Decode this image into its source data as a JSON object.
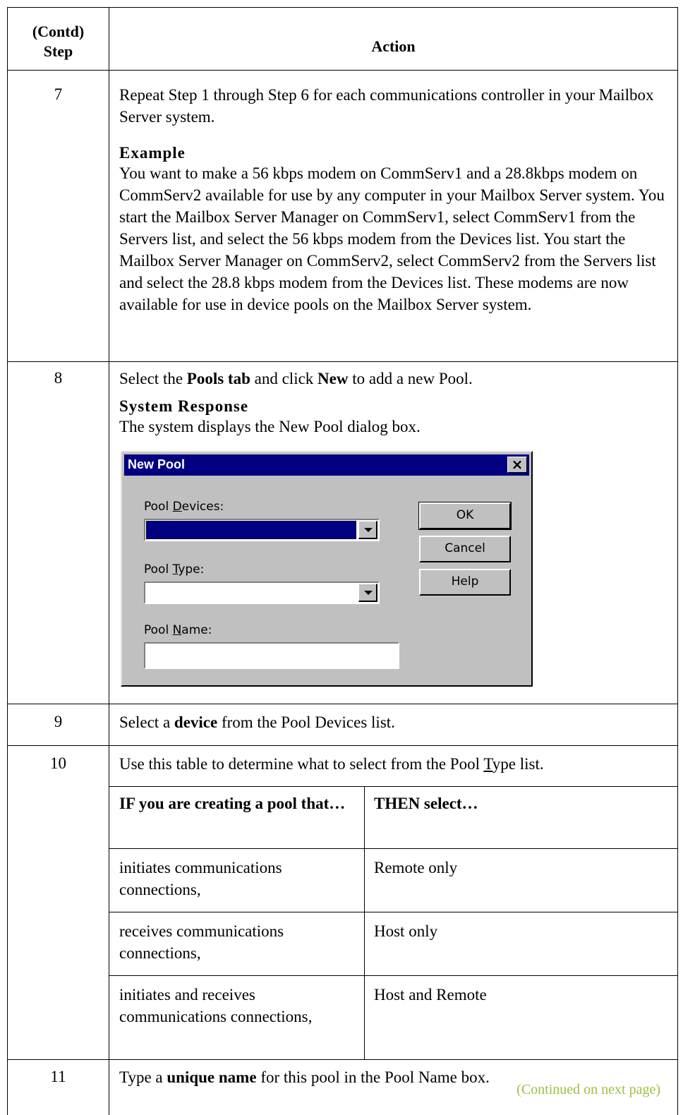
{
  "header": {
    "step_line1": "(Contd)",
    "step_line2": "Step",
    "action": "Action"
  },
  "steps": [
    {
      "num": "7",
      "text": "Repeat Step 1 through Step 6 for each communications controller in your Mailbox Server system.",
      "sub_heading": "Example",
      "sub_text": "You want to make a 56 kbps modem on CommServ1 and a 28.8kbps modem on CommServ2 available for use by any computer in your Mailbox Server system. You start the Mailbox Server Manager on CommServ1, select CommServ1 from the Servers list, and select the 56 kbps modem from the Devices list. You start the Mailbox Server Manager on CommServ2, select CommServ2 from the Servers list and select the 28.8 kbps modem from the Devices list. These modems are now available for use in device pools on the Mailbox Server system."
    },
    {
      "num": "8",
      "text_a": "Select the ",
      "text_b": "Pools tab",
      "text_c": " and click ",
      "text_d": "New",
      "text_e": " to add a new Pool.",
      "sub_heading": "System Response",
      "sub_text": "The system displays the New Pool dialog box."
    },
    {
      "num": "9",
      "text_a": "Select a ",
      "text_b": "device",
      "text_c": " from the Pool Devices list."
    },
    {
      "num": "10",
      "text_a": "Use this table to determine what to select from the Pool ",
      "text_b": "T",
      "text_c": "ype list."
    },
    {
      "num": "11",
      "text_a": "Type a ",
      "text_b": "unique name",
      "text_c": " for this pool in the Pool Name box."
    }
  ],
  "dialog": {
    "title": "New Pool",
    "close": "×",
    "pool_devices_label_pre": "Pool ",
    "pool_devices_label_ul": "D",
    "pool_devices_label_post": "evices:",
    "pool_type_label_pre": "Pool ",
    "pool_type_label_ul": "T",
    "pool_type_label_post": "ype:",
    "pool_name_label_pre": "Pool ",
    "pool_name_label_ul": "N",
    "pool_name_label_post": "ame:",
    "ok": "OK",
    "cancel": "Cancel",
    "help": "Help"
  },
  "pool_table": {
    "headers": [
      "IF you are creating a pool that…",
      "THEN select…"
    ],
    "rows": [
      [
        "initiates communications connections,",
        "Remote only"
      ],
      [
        "receives communications connections,",
        "Host only"
      ],
      [
        "initiates and receives communications connections,",
        "Host and Remote"
      ]
    ]
  },
  "footer": {
    "continued": "(Continued on next page)"
  }
}
